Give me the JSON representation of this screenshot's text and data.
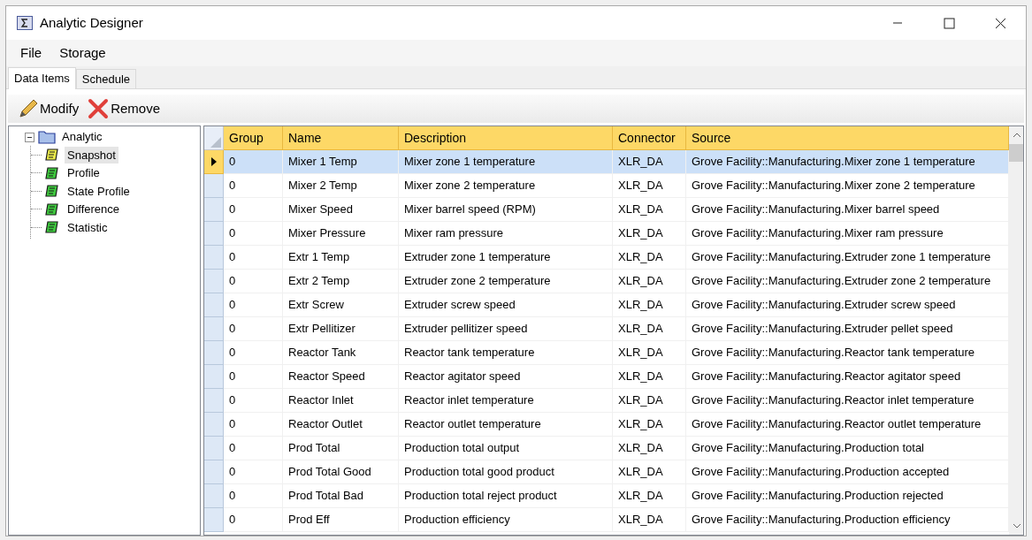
{
  "window": {
    "title": "Analytic Designer"
  },
  "menu": [
    "File",
    "Storage"
  ],
  "tabs": [
    {
      "label": "Data Items",
      "selected": true
    },
    {
      "label": "Schedule",
      "selected": false
    }
  ],
  "toolbar": [
    {
      "label": "Modify",
      "kind": "edit"
    },
    {
      "label": "Remove",
      "kind": "delete"
    }
  ],
  "tree": [
    {
      "label": "Analytic",
      "expanded": true,
      "selected": false,
      "children": [
        {
          "label": "Snapshot",
          "selected": true
        },
        {
          "label": "Profile",
          "selected": false
        },
        {
          "label": "State Profile",
          "selected": false
        },
        {
          "label": "Difference",
          "selected": false
        },
        {
          "label": "Statistic",
          "selected": false
        }
      ]
    }
  ],
  "table": {
    "columns": [
      "Group",
      "Name",
      "Description",
      "Connector",
      "Source"
    ],
    "rows": [
      {
        "selected": true,
        "cells": [
          "0",
          "Mixer 1 Temp",
          "Mixer zone 1 temperature",
          "XLR_DA",
          "Grove Facility::Manufacturing.Mixer zone 1 temperature"
        ]
      },
      {
        "selected": false,
        "cells": [
          "0",
          "Mixer 2 Temp",
          "Mixer zone 2 temperature",
          "XLR_DA",
          "Grove Facility::Manufacturing.Mixer zone 2 temperature"
        ]
      },
      {
        "selected": false,
        "cells": [
          "0",
          "Mixer Speed",
          "Mixer barrel speed (RPM)",
          "XLR_DA",
          "Grove Facility::Manufacturing.Mixer barrel speed"
        ]
      },
      {
        "selected": false,
        "cells": [
          "0",
          "Mixer Pressure",
          "Mixer ram pressure",
          "XLR_DA",
          "Grove Facility::Manufacturing.Mixer ram pressure"
        ]
      },
      {
        "selected": false,
        "cells": [
          "0",
          "Extr 1 Temp",
          "Extruder zone 1 temperature",
          "XLR_DA",
          "Grove Facility::Manufacturing.Extruder zone 1 temperature"
        ]
      },
      {
        "selected": false,
        "cells": [
          "0",
          "Extr 2 Temp",
          "Extruder zone 2 temperature",
          "XLR_DA",
          "Grove Facility::Manufacturing.Extruder zone 2 temperature"
        ]
      },
      {
        "selected": false,
        "cells": [
          "0",
          "Extr Screw",
          "Extruder screw speed",
          "XLR_DA",
          "Grove Facility::Manufacturing.Extruder screw speed"
        ]
      },
      {
        "selected": false,
        "cells": [
          "0",
          "Extr Pellitizer",
          "Extruder pellitizer speed",
          "XLR_DA",
          "Grove Facility::Manufacturing.Extruder pellet speed"
        ]
      },
      {
        "selected": false,
        "cells": [
          "0",
          "Reactor Tank",
          "Reactor tank temperature",
          "XLR_DA",
          "Grove Facility::Manufacturing.Reactor tank temperature"
        ]
      },
      {
        "selected": false,
        "cells": [
          "0",
          "Reactor Speed",
          "Reactor agitator speed",
          "XLR_DA",
          "Grove Facility::Manufacturing.Reactor agitator speed"
        ]
      },
      {
        "selected": false,
        "cells": [
          "0",
          "Reactor Inlet",
          "Reactor inlet temperature",
          "XLR_DA",
          "Grove Facility::Manufacturing.Reactor inlet temperature"
        ]
      },
      {
        "selected": false,
        "cells": [
          "0",
          "Reactor Outlet",
          "Reactor outlet temperature",
          "XLR_DA",
          "Grove Facility::Manufacturing.Reactor outlet temperature"
        ]
      },
      {
        "selected": false,
        "cells": [
          "0",
          "Prod Total",
          "Production total output",
          "XLR_DA",
          "Grove Facility::Manufacturing.Production total"
        ]
      },
      {
        "selected": false,
        "cells": [
          "0",
          "Prod Total Good",
          "Production total good product",
          "XLR_DA",
          "Grove Facility::Manufacturing.Production accepted"
        ]
      },
      {
        "selected": false,
        "cells": [
          "0",
          "Prod Total Bad",
          "Production total reject product",
          "XLR_DA",
          "Grove Facility::Manufacturing.Production rejected"
        ]
      },
      {
        "selected": false,
        "cells": [
          "0",
          "Prod Eff",
          "Production efficiency",
          "XLR_DA",
          "Grove Facility::Manufacturing.Production efficiency"
        ]
      }
    ]
  }
}
